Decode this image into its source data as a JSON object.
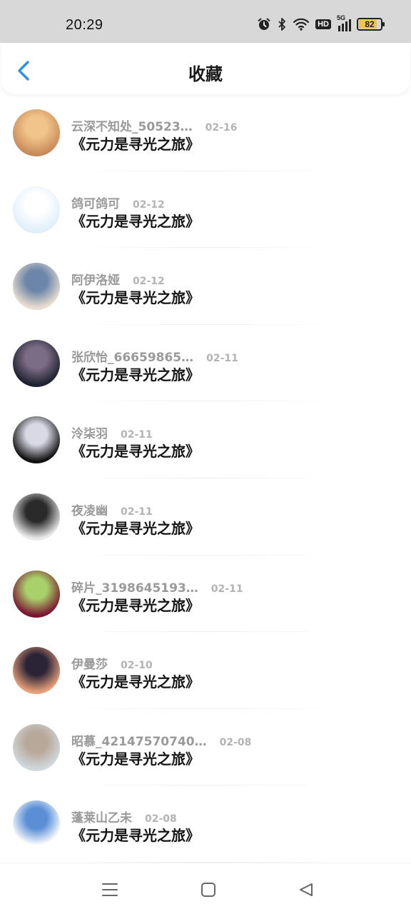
{
  "status_bar": {
    "time": "20:29",
    "battery": "82",
    "battery_level": 0.82,
    "hd_label": "HD",
    "network_label": "5G",
    "icons": [
      "alarm-icon",
      "bluetooth-icon",
      "wifi-icon",
      "hd-icon",
      "5g-signal-icon",
      "battery-icon"
    ]
  },
  "header": {
    "title": "收藏",
    "back_icon": "chevron-left-icon",
    "accent": "#2f8fe6"
  },
  "favorites": [
    {
      "user": "云深不知处_50523…",
      "date": "02-16",
      "book": "《元力是寻光之旅》",
      "avatar_colors": [
        "#c98a5a",
        "#f0c48a"
      ]
    },
    {
      "user": "鸽可鸽可",
      "date": "02-12",
      "book": "《元力是寻光之旅》",
      "avatar_colors": [
        "#dfeffc",
        "#ffffff"
      ]
    },
    {
      "user": "阿伊洛娅",
      "date": "02-12",
      "book": "《元力是寻光之旅》",
      "avatar_colors": [
        "#e8ddd0",
        "#6b86a8"
      ]
    },
    {
      "user": "张欣怡_66659865…",
      "date": "02-11",
      "book": "《元力是寻光之旅》",
      "avatar_colors": [
        "#1f2230",
        "#7c6d86"
      ]
    },
    {
      "user": "泠柒羽",
      "date": "02-11",
      "book": "《元力是寻光之旅》",
      "avatar_colors": [
        "#111111",
        "#d9d9e6"
      ]
    },
    {
      "user": "夜凌幽",
      "date": "02-11",
      "book": "《元力是寻光之旅》",
      "avatar_colors": [
        "#e9e9e9",
        "#2a2a2a"
      ]
    },
    {
      "user": "碎片_3198645193…",
      "date": "02-11",
      "book": "《元力是寻光之旅》",
      "avatar_colors": [
        "#7a1730",
        "#a9d16b"
      ]
    },
    {
      "user": "伊曼莎",
      "date": "02-10",
      "book": "《元力是寻光之旅》",
      "avatar_colors": [
        "#e6a07a",
        "#2b2336"
      ]
    },
    {
      "user": "昭慕_42147570740…",
      "date": "02-08",
      "book": "《元力是寻光之旅》",
      "avatar_colors": [
        "#cfd8dc",
        "#b8a89a"
      ]
    },
    {
      "user": "蓬莱山乙未",
      "date": "02-08",
      "book": "《元力是寻光之旅》",
      "avatar_colors": [
        "#ffffff",
        "#5a8fd6"
      ]
    }
  ],
  "nav_bar": {
    "buttons": [
      "menu-icon",
      "home-square-icon",
      "back-triangle-icon"
    ]
  }
}
